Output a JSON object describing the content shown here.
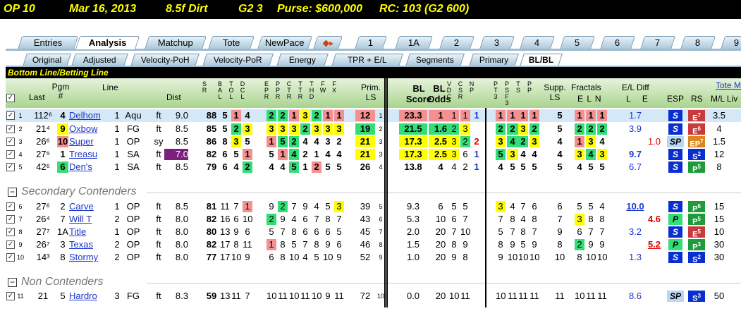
{
  "header": {
    "race": "OP  10",
    "date": "Mar 16, 2013",
    "surface": "8.5f  Dirt",
    "grade": "G2  3",
    "purse": "Purse: $600,000",
    "rc": "RC: 103  (G2 600)"
  },
  "tabs": [
    "Entries",
    "Analysis",
    "Matchup",
    "Tote",
    "NewPace",
    "1",
    "1A",
    "2",
    "3",
    "4",
    "5",
    "6",
    "7",
    "8",
    "9"
  ],
  "subtabs": [
    "Original",
    "Adjusted",
    "Velocity-PoH",
    "Velocity-PoR",
    "Energy",
    "TPR + E/L",
    "Segments",
    "Primary",
    "BL/BL"
  ],
  "view_title": "Bottom Line/Betting Line",
  "columns": {
    "last": "Last",
    "pgm": "Pgm #",
    "line": "Line",
    "dist": "Dist",
    "prim": "Prim. LS",
    "bl_score": "BL Score",
    "bl_odds": "BL Odds",
    "supp": "Supp. LS",
    "fractals": "Fractals",
    "el": "E L N",
    "eldiff": "E/L Diff",
    "eldiff_le": "L     E",
    "esp": "ESP",
    "rs": "RS",
    "tote": "Tote M",
    "ml": "M/L Liv"
  },
  "vcols": {
    "s": "SR",
    "b": "BAL",
    "t": "TOL",
    "d": "DCL",
    "e": "EPR",
    "p": "PPR",
    "c": "CTR",
    "t2": "TTR",
    "h": "THD",
    "f": "FW",
    "f2": "FX",
    "v": "VDC",
    "c2": "CSR",
    "n": "NP",
    "pt": "PT3",
    "ps": "PSF3",
    "ts": "TS",
    "pp": "PP"
  },
  "sections": {
    "secondary": "Secondary Contenders",
    "non": "Non Contenders"
  },
  "horses": [
    {
      "n": "1",
      "last": "112⁶",
      "pgm": "4",
      "name": "Delhom",
      "ln": "1",
      "trk": "Aqu",
      "dt": "ft",
      "dist": "9.0",
      "s": "88",
      "b": "5",
      "t": "1",
      "d": "4",
      "e": "2",
      "p": "2",
      "c": "1",
      "t2": "3",
      "h": "2",
      "f": "1",
      "f2": "1",
      "pr": "12",
      "prs": "1",
      "bls": "23.3",
      "blo": "1",
      "v": "1",
      "c2": "1",
      "np": "1",
      "pt": "1",
      "ps": "1",
      "ts": "1",
      "pp": "1",
      "sl": "5",
      "fe": "1",
      "fl": "1",
      "fn": "1",
      "l": "1.7",
      "ee": "",
      "esp": "S",
      "rs": "E",
      "rsx": "7",
      "ml": "3.5"
    },
    {
      "n": "2",
      "last": "21⁴",
      "pgm": "9",
      "name": "Oxbow",
      "ln": "1",
      "trk": "FG",
      "dt": "ft",
      "dist": "8.5",
      "s": "85",
      "b": "5",
      "t": "2",
      "d": "3",
      "e": "3",
      "p": "3",
      "c": "3",
      "t2": "2",
      "h": "3",
      "f": "3",
      "f2": "3",
      "pr": "19",
      "prs": "2",
      "bls": "21.5",
      "blo": "1.6",
      "v": "2",
      "c2": "3",
      "np": "",
      "pt": "2",
      "ps": "2",
      "ts": "3",
      "pp": "2",
      "sl": "5",
      "fe": "2",
      "fl": "2",
      "fn": "2",
      "l": "3.9",
      "ee": "",
      "esp": "S",
      "rs": "E",
      "rsx": "6",
      "ml": "4"
    },
    {
      "n": "3",
      "last": "26⁶",
      "pgm": "10",
      "name": "Super",
      "ln": "1",
      "trk": "OP",
      "dt": "sy",
      "dist": "8.5",
      "s": "86",
      "b": "8",
      "t": "3",
      "d": "5",
      "e": "1",
      "p": "5",
      "c": "2",
      "t2": "4",
      "h": "4",
      "f": "3",
      "f2": "2",
      "pr": "21",
      "prs": "3",
      "bls": "17.3",
      "blo": "2.5",
      "v": "3",
      "c2": "2",
      "np": "2",
      "pt": "3",
      "ps": "4",
      "ts": "2",
      "pp": "3",
      "sl": "4",
      "fe": "1",
      "fl": "3",
      "fn": "4",
      "l": "",
      "ee": "1.0",
      "esp": "SP",
      "rs": "EP",
      "rsx": "7",
      "ml": "1.5"
    },
    {
      "n": "4",
      "last": "27⁵",
      "pgm": "1",
      "name": "Treasu",
      "ln": "1",
      "trk": "SA",
      "dt": "ft",
      "dist": "7.0",
      "s": "82",
      "b": "6",
      "t": "5",
      "d": "1",
      "e": "5",
      "p": "1",
      "c": "4",
      "t2": "2",
      "h": "1",
      "f": "4",
      "f2": "4",
      "pr": "21",
      "prs": "3",
      "bls": "17.3",
      "blo": "2.5",
      "v": "3",
      "c2": "6",
      "np": "1",
      "pt": "5",
      "ps": "3",
      "ts": "4",
      "pp": "4",
      "sl": "4",
      "fe": "3",
      "fl": "4",
      "fn": "3",
      "l": "9.7",
      "ee": "",
      "esp": "S",
      "rs": "S",
      "rsx": "2",
      "ml": "12"
    },
    {
      "n": "5",
      "last": "42⁶",
      "pgm": "6",
      "name": "Den's",
      "ln": "1",
      "trk": "SA",
      "dt": "ft",
      "dist": "8.5",
      "s": "79",
      "b": "6",
      "t": "4",
      "d": "2",
      "e": "4",
      "p": "4",
      "c": "5",
      "t2": "1",
      "h": "2",
      "f": "5",
      "f2": "5",
      "pr": "26",
      "prs": "4",
      "bls": "13.8",
      "blo": "4",
      "v": "4",
      "c2": "2",
      "np": "1",
      "pt": "4",
      "ps": "5",
      "ts": "5",
      "pp": "5",
      "sl": "5",
      "fe": "4",
      "fl": "5",
      "fn": "5",
      "l": "6.7",
      "ee": "",
      "esp": "S",
      "rs": "P",
      "rsx": "5",
      "ml": "8"
    },
    {
      "n": "6",
      "last": "27⁶",
      "pgm": "2",
      "name": "Carve",
      "ln": "1",
      "trk": "OP",
      "dt": "ft",
      "dist": "8.5",
      "s": "81",
      "b": "11",
      "t": "7",
      "d": "1",
      "e": "9",
      "p": "2",
      "c": "7",
      "t2": "9",
      "h": "4",
      "f": "5",
      "f2": "3",
      "pr": "39",
      "prs": "5",
      "bls": "9.3",
      "blo": "6",
      "v": "5",
      "c2": "5",
      "np": "",
      "pt": "3",
      "ps": "4",
      "ts": "7",
      "pp": "6",
      "sl": "6",
      "fe": "5",
      "fl": "5",
      "fn": "4",
      "l": "10.0",
      "ee": "",
      "esp": "S",
      "rs": "P",
      "rsx": "6",
      "ml": "15"
    },
    {
      "n": "7",
      "last": "26⁴",
      "pgm": "7",
      "name": "Will T",
      "ln": "2",
      "trk": "OP",
      "dt": "ft",
      "dist": "8.0",
      "s": "82",
      "b": "16",
      "t": "6",
      "d": "10",
      "e": "2",
      "p": "9",
      "c": "4",
      "t2": "6",
      "h": "7",
      "f": "8",
      "f2": "7",
      "pr": "43",
      "prs": "6",
      "bls": "5.3",
      "blo": "10",
      "v": "6",
      "c2": "7",
      "np": "",
      "pt": "7",
      "ps": "8",
      "ts": "4",
      "pp": "8",
      "sl": "7",
      "fe": "3",
      "fl": "8",
      "fn": "8",
      "l": "",
      "ee": "4.6",
      "esp": "P",
      "rs": "P",
      "rsx": "5",
      "ml": "15"
    },
    {
      "n": "8",
      "last": "27⁷",
      "pgm": "1A",
      "name": "Title",
      "ln": "1",
      "trk": "OP",
      "dt": "ft",
      "dist": "8.0",
      "s": "80",
      "b": "13",
      "t": "9",
      "d": "6",
      "e": "5",
      "p": "7",
      "c": "8",
      "t2": "6",
      "h": "6",
      "f": "6",
      "f2": "5",
      "pr": "45",
      "prs": "7",
      "bls": "2.0",
      "blo": "20",
      "v": "7",
      "c2": "10",
      "np": "",
      "pt": "5",
      "ps": "7",
      "ts": "8",
      "pp": "7",
      "sl": "9",
      "fe": "6",
      "fl": "7",
      "fn": "7",
      "l": "3.2",
      "ee": "",
      "esp": "S",
      "rs": "E",
      "rsx": "5",
      "ml": "10"
    },
    {
      "n": "9",
      "last": "26⁷",
      "pgm": "3",
      "name": "Texas",
      "ln": "2",
      "trk": "OP",
      "dt": "ft",
      "dist": "8.0",
      "s": "82",
      "b": "17",
      "t": "8",
      "d": "11",
      "e": "1",
      "p": "8",
      "c": "5",
      "t2": "7",
      "h": "8",
      "f": "9",
      "f2": "6",
      "pr": "46",
      "prs": "8",
      "bls": "1.5",
      "blo": "20",
      "v": "8",
      "c2": "9",
      "np": "",
      "pt": "8",
      "ps": "9",
      "ts": "5",
      "pp": "9",
      "sl": "8",
      "fe": "2",
      "fl": "9",
      "fn": "9",
      "l": "",
      "ee": "5.2",
      "esp": "P",
      "rs": "P",
      "rsx": "3",
      "ml": "30"
    },
    {
      "n": "10",
      "last": "14³",
      "pgm": "8",
      "name": "Stormy",
      "ln": "2",
      "trk": "OP",
      "dt": "ft",
      "dist": "8.0",
      "s": "77",
      "b": "17",
      "t": "10",
      "d": "9",
      "e": "6",
      "p": "8",
      "c": "10",
      "t2": "4",
      "h": "5",
      "f": "10",
      "f2": "9",
      "pr": "52",
      "prs": "9",
      "bls": "1.0",
      "blo": "20",
      "v": "9",
      "c2": "8",
      "np": "",
      "pt": "9",
      "ps": "10",
      "ts": "10",
      "pp": "10",
      "sl": "10",
      "fe": "8",
      "fl": "10",
      "fn": "10",
      "l": "1.3",
      "ee": "",
      "esp": "S",
      "rs": "S",
      "rsx": "2",
      "ml": "30"
    },
    {
      "n": "11",
      "last": "21",
      "pgm": "5",
      "name": "Hardro",
      "ln": "3",
      "trk": "FG",
      "dt": "ft",
      "dist": "8.3",
      "s": "59",
      "b": "13",
      "t": "11",
      "d": "7",
      "e": "10",
      "p": "11",
      "c": "10",
      "t2": "11",
      "h": "10",
      "f": "9",
      "f2": "11",
      "pr": "72",
      "prs": "10",
      "bls": "0.0",
      "blo": "20",
      "v": "10",
      "c2": "11",
      "np": "",
      "pt": "10",
      "ps": "11",
      "ts": "11",
      "pp": "11",
      "sl": "11",
      "fe": "10",
      "fl": "11",
      "fn": "11",
      "l": "8.6",
      "ee": "",
      "esp": "SP",
      "rs": "S",
      "rsx": "3",
      "ml": "50"
    }
  ],
  "colors": {
    "green": "#33dd77",
    "yellow": "#ffff00",
    "red": "#f59090",
    "purple": "#7a1f7a",
    "blue": "#0a2fd0"
  }
}
